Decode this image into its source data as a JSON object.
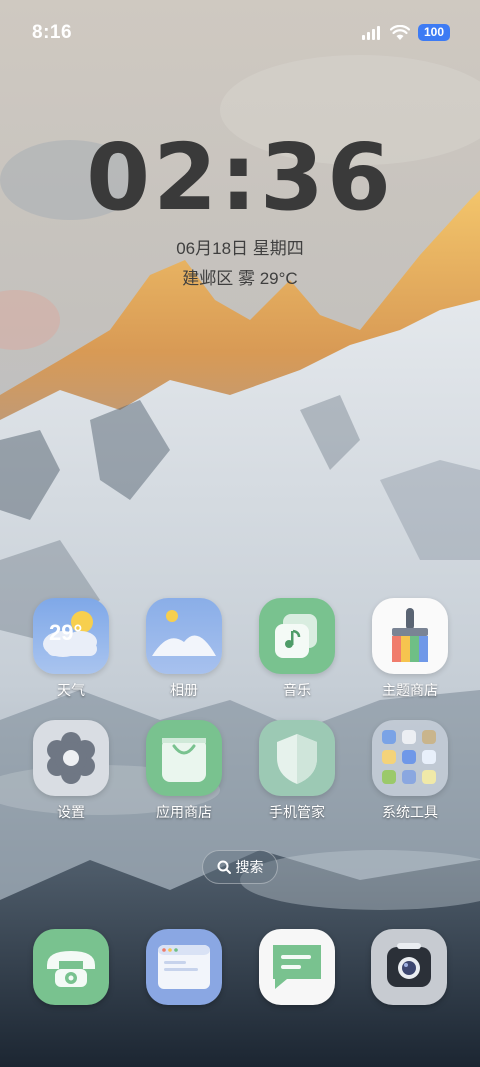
{
  "status_bar": {
    "time": "8:16",
    "battery": "100"
  },
  "clock": {
    "time": "02:36",
    "date": "06月18日 星期四",
    "weather": "建邺区 雾 29°C"
  },
  "apps": {
    "weather": {
      "label": "天气",
      "temp": "29°"
    },
    "gallery": {
      "label": "相册"
    },
    "music": {
      "label": "音乐"
    },
    "themes": {
      "label": "主题商店"
    },
    "settings": {
      "label": "设置"
    },
    "app_store": {
      "label": "应用商店"
    },
    "security": {
      "label": "手机管家"
    },
    "system_tools": {
      "label": "系统工具"
    }
  },
  "search": {
    "label": "搜索"
  },
  "dock": [
    "phone-icon",
    "browser-icon",
    "messages-icon",
    "camera-icon"
  ]
}
